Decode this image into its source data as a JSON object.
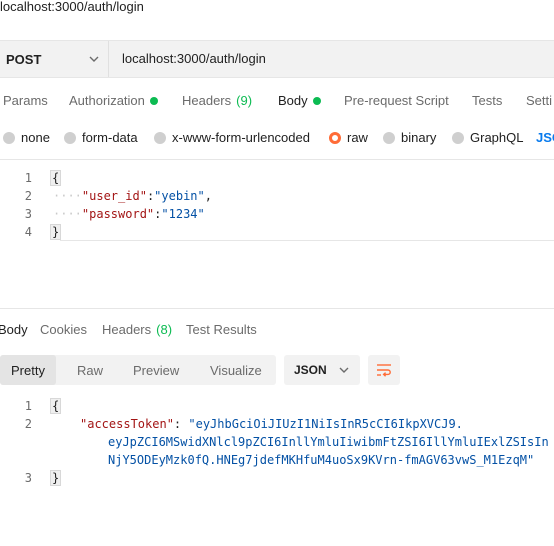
{
  "request": {
    "title": "localhost:3000/auth/login",
    "method": "POST",
    "url": "localhost:3000/auth/login"
  },
  "request_tabs": [
    {
      "label": "Params"
    },
    {
      "label": "Authorization"
    },
    {
      "label": "Headers"
    },
    {
      "label": "(9)"
    },
    {
      "label": "Body"
    },
    {
      "label": "Pre-request Script"
    },
    {
      "label": "Tests"
    },
    {
      "label": "Setti"
    }
  ],
  "body_types": [
    {
      "label": "none"
    },
    {
      "label": "form-data"
    },
    {
      "label": "x-www-form-urlencoded"
    },
    {
      "label": "raw"
    },
    {
      "label": "binary"
    },
    {
      "label": "GraphQL"
    },
    {
      "label": "JSO"
    }
  ],
  "request_body": {
    "line_numbers": [
      "1",
      "2",
      "3",
      "4"
    ],
    "open_brace": "{",
    "close_brace": "}",
    "indent": "····",
    "line2_key": "\"user_id\"",
    "line2_colon": ":",
    "line2_value": "\"yebin\"",
    "line2_comma": ",",
    "line3_key": "\"password\"",
    "line3_colon": ":",
    "line3_value": "\"1234\""
  },
  "response_tabs": [
    {
      "label": "Body"
    },
    {
      "label": "Cookies"
    },
    {
      "label": "Headers"
    },
    {
      "label": "(8)"
    },
    {
      "label": "Test Results"
    }
  ],
  "view_modes": [
    {
      "label": "Pretty"
    },
    {
      "label": "Raw"
    },
    {
      "label": "Preview"
    },
    {
      "label": "Visualize"
    }
  ],
  "format": {
    "selected": "JSON"
  },
  "response_body": {
    "line_numbers": [
      "1",
      "2",
      "3"
    ],
    "open_brace": "{",
    "close_brace": "}",
    "key": "\"accessToken\"",
    "colon": ": ",
    "token_line1": "\"eyJhbGciOiJIUzI1NiIsInR5cCI6IkpXVCJ9.",
    "token_line2": "eyJpZCI6MSwidXNlcl9pZCI6InllYmluIiwibmFtZSI6IllYmluIExlZSIsIn",
    "token_line3": "NjY5ODEyMzk0fQ.HNEg7jdefMKHfuM4uoSx9KVrn-fmAGV63vwS_M1EzqM\""
  },
  "icons": {
    "method_dropdown": "chevron-down-icon",
    "format_dropdown": "chevron-down-icon",
    "wrap": "wrap-lines-icon"
  },
  "colors": {
    "accent": "#ff6c37",
    "active_dot": "#0cbb52",
    "json_link": "#097bed"
  }
}
